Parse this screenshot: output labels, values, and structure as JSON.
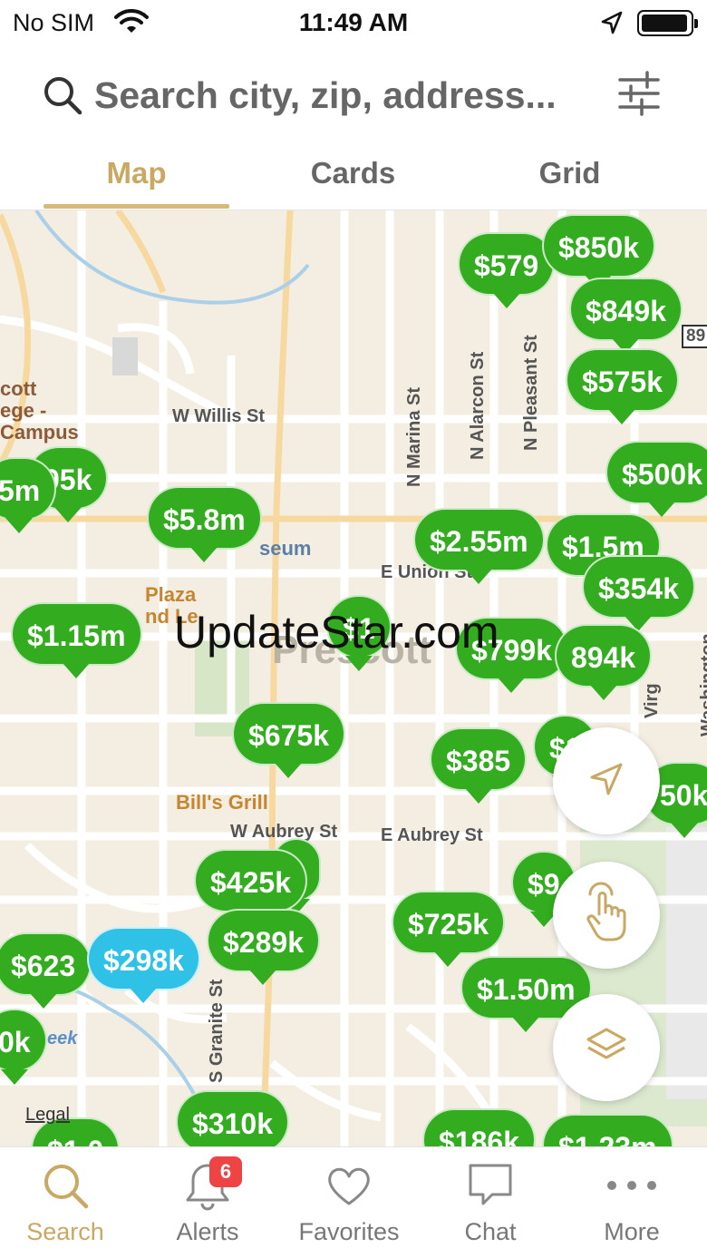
{
  "status_bar": {
    "carrier": "No SIM",
    "time": "11:49 AM"
  },
  "search": {
    "placeholder": "Search city, zip, address..."
  },
  "tabs": [
    {
      "label": "Map",
      "active": true
    },
    {
      "label": "Cards",
      "active": false
    },
    {
      "label": "Grid",
      "active": false
    }
  ],
  "map": {
    "street_labels": {
      "willis": "W Willis St",
      "marina": "N Marina St",
      "alarcon": "N Alarcon St",
      "pleasant": "N Pleasant St",
      "union": "E Union St",
      "aubrey_w": "W Aubrey St",
      "aubrey_e": "E Aubrey St",
      "granite": "S Granite St",
      "virginia": "Virg",
      "washington": "Washington",
      "route": "89",
      "creek": "eek"
    },
    "pois": {
      "college": "cott\nege -\nCampus",
      "museum": "seum",
      "plaza": "Plaza\nnd Le",
      "bills_grill": "Bill's Grill",
      "town": "Prescott"
    },
    "listings": [
      {
        "price": "$579"
      },
      {
        "price": "$850k"
      },
      {
        "price": "$849k"
      },
      {
        "price": "$575k"
      },
      {
        "price": "$500k"
      },
      {
        "price": "95k"
      },
      {
        "price": "5m"
      },
      {
        "price": "$5.8m"
      },
      {
        "price": "$2.55m"
      },
      {
        "price": "$1.5m"
      },
      {
        "price": "$354k"
      },
      {
        "price": "$1.15m"
      },
      {
        "price": "$1"
      },
      {
        "price": "$799k"
      },
      {
        "price": "894k"
      },
      {
        "price": "$675k"
      },
      {
        "price": "$385"
      },
      {
        "price": "$1"
      },
      {
        "price": "50k"
      },
      {
        "price": "k"
      },
      {
        "price": "$425k"
      },
      {
        "price": "$289k"
      },
      {
        "price": "$9"
      },
      {
        "price": "$725k"
      },
      {
        "price": "$623"
      },
      {
        "price": "$298k",
        "highlight": true
      },
      {
        "price": "$1.50m"
      },
      {
        "price": "0k"
      },
      {
        "price": "$310k"
      },
      {
        "price": "$186k"
      },
      {
        "price": "$1.23m"
      },
      {
        "price": "$1.0"
      }
    ],
    "watermark": "UpdateStar.com",
    "legal": "Legal"
  },
  "bottom_nav": [
    {
      "label": "Search",
      "icon": "search-icon",
      "active": true
    },
    {
      "label": "Alerts",
      "icon": "bell-icon",
      "badge": "6"
    },
    {
      "label": "Favorites",
      "icon": "heart-icon"
    },
    {
      "label": "Chat",
      "icon": "chat-icon"
    },
    {
      "label": "More",
      "icon": "more-dots-icon"
    }
  ],
  "colors": {
    "accent": "#c9a863",
    "pin_green": "#33ad1f",
    "pin_selected": "#2fc1e6",
    "badge_red": "#ef4444"
  }
}
